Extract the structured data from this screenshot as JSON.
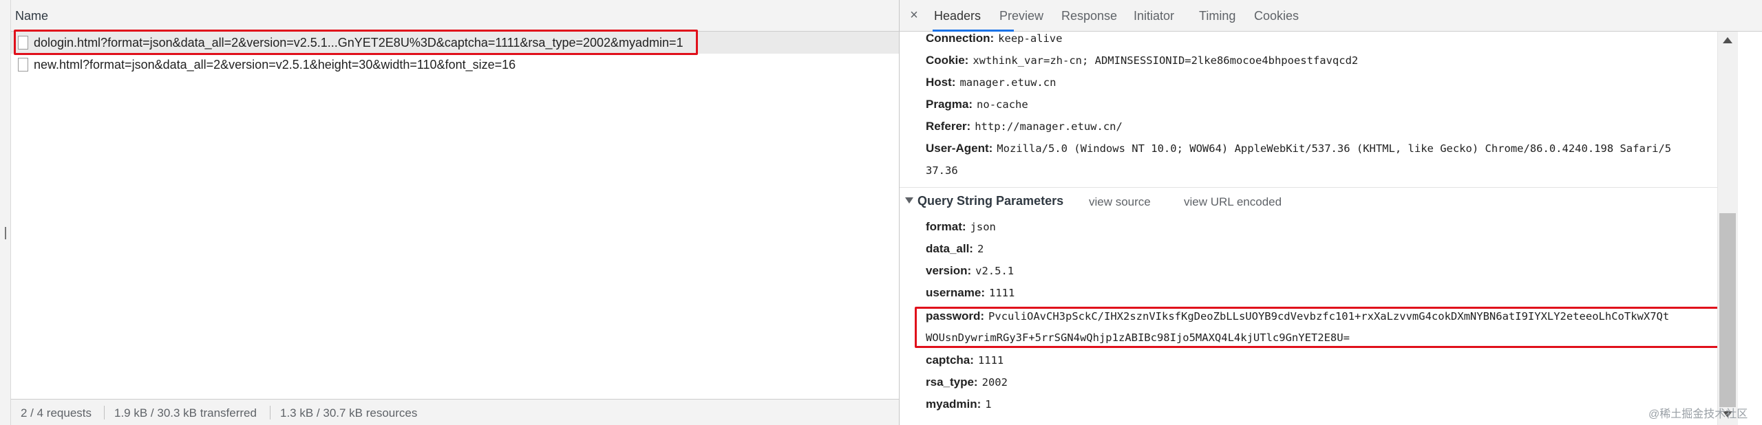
{
  "request_list": {
    "header": "Name",
    "rows": [
      {
        "name": "dologin.html?format=json&data_all=2&version=v2.5.1...GnYET2E8U%3D&captcha=1111&rsa_type=2002&myadmin=1"
      },
      {
        "name": "new.html?format=json&data_all=2&version=v2.5.1&height=30&width=110&font_size=16"
      }
    ]
  },
  "status_bar": {
    "requests": "2 / 4 requests",
    "transferred": "1.9 kB / 30.3 kB transferred",
    "resources": "1.3 kB / 30.7 kB resources"
  },
  "tabs": {
    "close": "×",
    "items": [
      "Headers",
      "Preview",
      "Response",
      "Initiator",
      "Timing",
      "Cookies"
    ],
    "active": "Headers"
  },
  "request_headers": [
    {
      "key": "Connection:",
      "value": "keep-alive"
    },
    {
      "key": "Cookie:",
      "value": "xwthink_var=zh-cn; ADMINSESSIONID=2lke86mocoe4bhpoestfavqcd2"
    },
    {
      "key": "Host:",
      "value": "manager.etuw.cn"
    },
    {
      "key": "Pragma:",
      "value": "no-cache"
    },
    {
      "key": "Referer:",
      "value": "http://manager.etuw.cn/"
    },
    {
      "key": "User-Agent:",
      "value": "Mozilla/5.0 (Windows NT 10.0; WOW64) AppleWebKit/537.36 (KHTML, like Gecko) Chrome/86.0.4240.198 Safari/5",
      "continuation": "37.36"
    }
  ],
  "query_string": {
    "title": "Query String Parameters",
    "view_source": "view source",
    "view_url_encoded": "view URL encoded",
    "params": [
      {
        "key": "format:",
        "value": "json"
      },
      {
        "key": "data_all:",
        "value": "2"
      },
      {
        "key": "version:",
        "value": "v2.5.1"
      },
      {
        "key": "username:",
        "value": "1111"
      },
      {
        "key": "password:",
        "value": "PvculiOAvCH3pSckC/IHX2sznVIksfKgDeoZbLLsUOYB9cdVevbzfc101+rxXaLzvvmG4cokDXmNYBN6atI9IYXLY2eteeoLhCoTkwX7Qt",
        "continuation": "WOUsnDywrimRGy3F+5rrSGN4wQhjp1zABIBc98Ijo5MAXQ4L4kjUTlc9GnYET2E8U="
      },
      {
        "key": "captcha:",
        "value": "1111"
      },
      {
        "key": "rsa_type:",
        "value": "2002"
      },
      {
        "key": "myadmin:",
        "value": "1"
      }
    ]
  },
  "watermark": "@稀土掘金技术社区",
  "colors": {
    "highlight": "#e0101b",
    "active_tab": "#1a73e8"
  }
}
